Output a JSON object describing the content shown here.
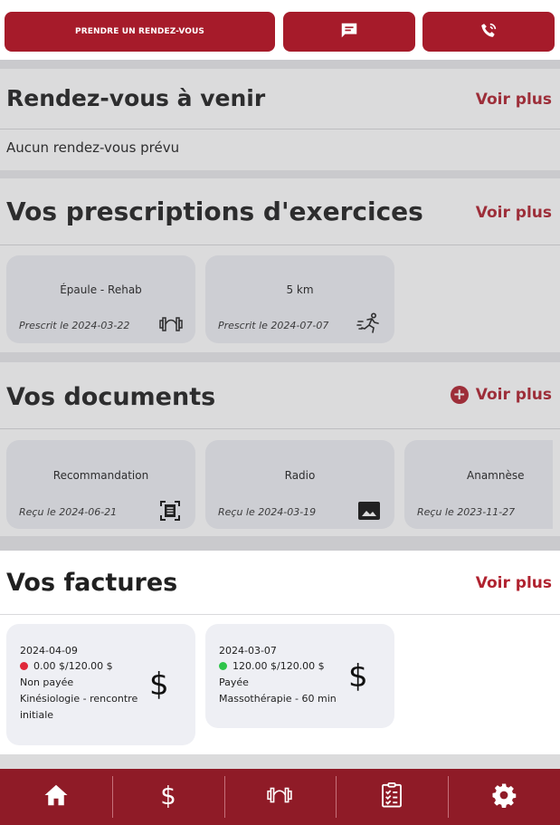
{
  "top_actions": {
    "appointment_label": "PRENDRE UN RENDEZ-VOUS",
    "message_icon": "message-icon",
    "phone_icon": "phone-icon"
  },
  "appointments": {
    "title": "Rendez-vous à venir",
    "more_label": "Voir plus",
    "empty_text": "Aucun rendez-vous prévu"
  },
  "prescriptions": {
    "title": "Vos prescriptions d'exercices",
    "more_label": "Voir plus",
    "items": [
      {
        "title": "Épaule - Rehab",
        "date": "Prescrit le 2024-03-22",
        "icon": "dumbbell-icon"
      },
      {
        "title": "5 km",
        "date": "Prescrit le 2024-07-07",
        "icon": "runner-icon"
      }
    ]
  },
  "documents": {
    "title": "Vos documents",
    "more_label": "Voir plus",
    "items": [
      {
        "title": "Recommandation",
        "date": "Reçu le 2024-06-21",
        "icon": "document-scan-icon"
      },
      {
        "title": "Radio",
        "date": "Reçu le 2024-03-19",
        "icon": "image-icon"
      },
      {
        "title": "Anamnèse",
        "date": "Reçu le 2023-11-27",
        "icon": ""
      }
    ]
  },
  "invoices": {
    "title": "Vos factures",
    "more_label": "Voir plus",
    "items": [
      {
        "date": "2024-04-09",
        "amount": "0.00 $/120.00 $",
        "status": "Non payée",
        "status_color": "#e0283a",
        "service": "Kinésiologie - rencontre initiale",
        "service_line1": "Kinésiologie - rencontre",
        "service_line2": "initiale",
        "symbol": "$"
      },
      {
        "date": "2024-03-07",
        "amount": "120.00 $/120.00 $",
        "status": "Payée",
        "status_color": "#2ec44a",
        "service": "Massothérapie - 60 min",
        "symbol": "$"
      }
    ]
  },
  "tabbar": {
    "items": [
      "home-icon",
      "dollar-icon",
      "dumbbell-icon",
      "clipboard-icon",
      "gear-icon"
    ]
  },
  "colors": {
    "brand_red": "#a61b2a",
    "tabbar_red": "#8f1b27",
    "link_red": "#b0222f"
  }
}
